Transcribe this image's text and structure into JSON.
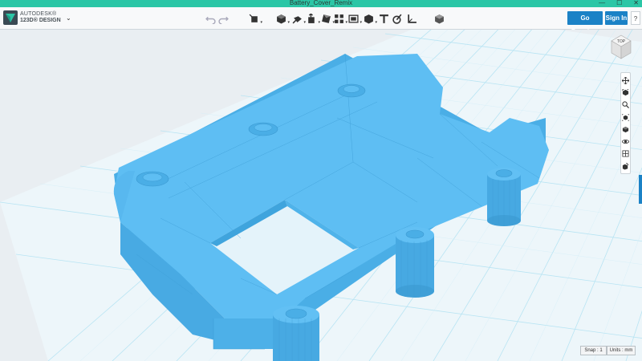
{
  "window": {
    "title": "Battery_Cover_Remix",
    "minimize": "—",
    "maximize": "☐",
    "close": "✕"
  },
  "app": {
    "brand_line1": "AUTODESK®",
    "brand_line2": "123D® DESIGN"
  },
  "toolbar": {
    "tools": [
      "undo-icon",
      "redo-icon",
      "transform-icon",
      "primitives-icon",
      "sketch-icon",
      "construct-icon",
      "modify-icon",
      "pattern-icon",
      "grouping-icon",
      "combine-icon",
      "measure-icon",
      "text-icon",
      "snap-icon",
      "ruler-icon",
      "material-icon"
    ],
    "premium_label": "Go Premium",
    "signin_label": "Sign In",
    "help_label": "?"
  },
  "viewcube": {
    "face_label": "TOP"
  },
  "navbar": {
    "tools": [
      "pan-icon",
      "orbit-icon",
      "zoom-icon",
      "fit-icon",
      "view-mode-icon",
      "visibility-icon",
      "grid-icon",
      "material-view-icon"
    ]
  },
  "status": {
    "snap": "Snap : 1",
    "units": "Units : mm"
  },
  "colors": {
    "accent": "#1b82c6",
    "titlebar": "#2bc6a6",
    "model": "#56b7f1",
    "grid": "#b8e4f3"
  }
}
